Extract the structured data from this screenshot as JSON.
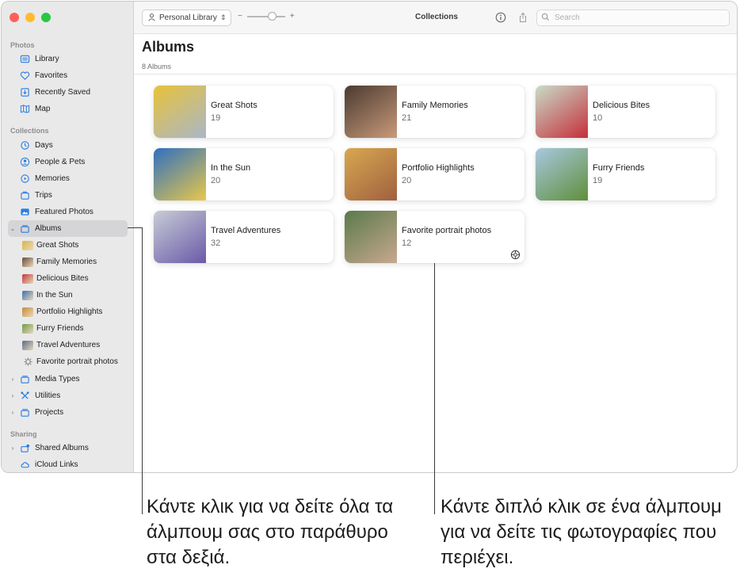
{
  "window": {
    "traffic_lights": [
      "#ff5f57",
      "#febc2e",
      "#28c840"
    ]
  },
  "sidebar": {
    "sections": {
      "photos": "Photos",
      "collections": "Collections",
      "sharing": "Sharing"
    },
    "photos_items": [
      {
        "label": "Library",
        "icon": "library-icon"
      },
      {
        "label": "Favorites",
        "icon": "heart-icon"
      },
      {
        "label": "Recently Saved",
        "icon": "saved-icon"
      },
      {
        "label": "Map",
        "icon": "map-icon"
      }
    ],
    "collections_items": [
      {
        "label": "Days",
        "icon": "days-icon"
      },
      {
        "label": "People & Pets",
        "icon": "people-icon"
      },
      {
        "label": "Memories",
        "icon": "memories-icon"
      },
      {
        "label": "Trips",
        "icon": "trips-icon"
      },
      {
        "label": "Featured Photos",
        "icon": "featured-icon"
      },
      {
        "label": "Albums",
        "icon": "album-stack-icon",
        "selected": true
      }
    ],
    "album_items": [
      {
        "label": "Great Shots",
        "color": "#d9b64a"
      },
      {
        "label": "Family Memories",
        "color": "#6b4a3a"
      },
      {
        "label": "Delicious Bites",
        "color": "#c23a3a"
      },
      {
        "label": "In the Sun",
        "color": "#3e6fb0"
      },
      {
        "label": "Portfolio Highlights",
        "color": "#c98a3a"
      },
      {
        "label": "Furry Friends",
        "color": "#6f9a4a"
      },
      {
        "label": "Travel Adventures",
        "color": "#5a6a8a"
      },
      {
        "label": "Favorite portrait photos",
        "icon": "smart-album-gear-icon"
      }
    ],
    "more_items": [
      {
        "label": "Media Types",
        "icon": "album-stack-icon"
      },
      {
        "label": "Utilities",
        "icon": "utilities-icon"
      },
      {
        "label": "Projects",
        "icon": "album-stack-icon"
      }
    ],
    "sharing_items": [
      {
        "label": "Shared Albums",
        "icon": "shared-albums-icon"
      },
      {
        "label": "iCloud Links",
        "icon": "icloud-icon"
      }
    ]
  },
  "toolbar": {
    "library_label": "Personal Library",
    "zoom_minus": "−",
    "zoom_plus": "+",
    "zoom_level": 0.65,
    "title": "Collections",
    "search_placeholder": "Search"
  },
  "main": {
    "title": "Albums",
    "count_label": "8 Albums",
    "albums": [
      {
        "name": "Great Shots",
        "count": "19",
        "colors": [
          "#e8c23a",
          "#a9b7c8"
        ]
      },
      {
        "name": "Family Memories",
        "count": "21",
        "colors": [
          "#4a3a30",
          "#c99a7a"
        ]
      },
      {
        "name": "Delicious Bites",
        "count": "10",
        "colors": [
          "#c8dcc8",
          "#c42f3a"
        ]
      },
      {
        "name": "In the Sun",
        "count": "20",
        "colors": [
          "#2f6fc0",
          "#e8c84a"
        ]
      },
      {
        "name": "Portfolio Highlights",
        "count": "20",
        "colors": [
          "#d8a850",
          "#a06040"
        ]
      },
      {
        "name": "Furry Friends",
        "count": "19",
        "colors": [
          "#a8c8e0",
          "#5f8f3a"
        ]
      },
      {
        "name": "Travel Adventures",
        "count": "32",
        "colors": [
          "#c8ccd6",
          "#6a5aa8"
        ]
      },
      {
        "name": "Favorite portrait photos",
        "count": "12",
        "colors": [
          "#5a7a4a",
          "#c8a890"
        ],
        "smart": true
      }
    ]
  },
  "callouts": {
    "left": "Κάντε κλικ για να δείτε όλα τα άλμπουμ σας στο παράθυρο στα δεξιά.",
    "right": "Κάντε διπλό κλικ σε ένα άλμπουμ για να δείτε τις φωτογραφίες που περιέχει."
  }
}
